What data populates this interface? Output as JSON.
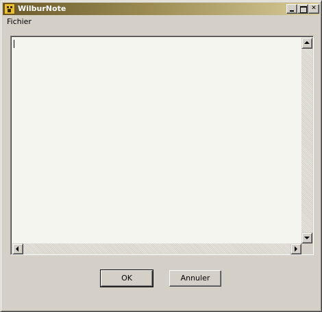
{
  "window": {
    "title": "WilburNote",
    "icon": "app-face-icon",
    "controls": {
      "minimize": "minimize-icon",
      "maximize": "maximize-icon",
      "close": "✕"
    }
  },
  "menubar": {
    "items": [
      {
        "label": "Fichier"
      }
    ]
  },
  "editor": {
    "value": ""
  },
  "buttons": {
    "ok_label": "OK",
    "cancel_label": "Annuler"
  },
  "colors": {
    "face": "#d4d0c8",
    "editor_bg": "#f5f5f0",
    "title_start": "#6b5a2a",
    "title_end": "#d8cc98"
  }
}
